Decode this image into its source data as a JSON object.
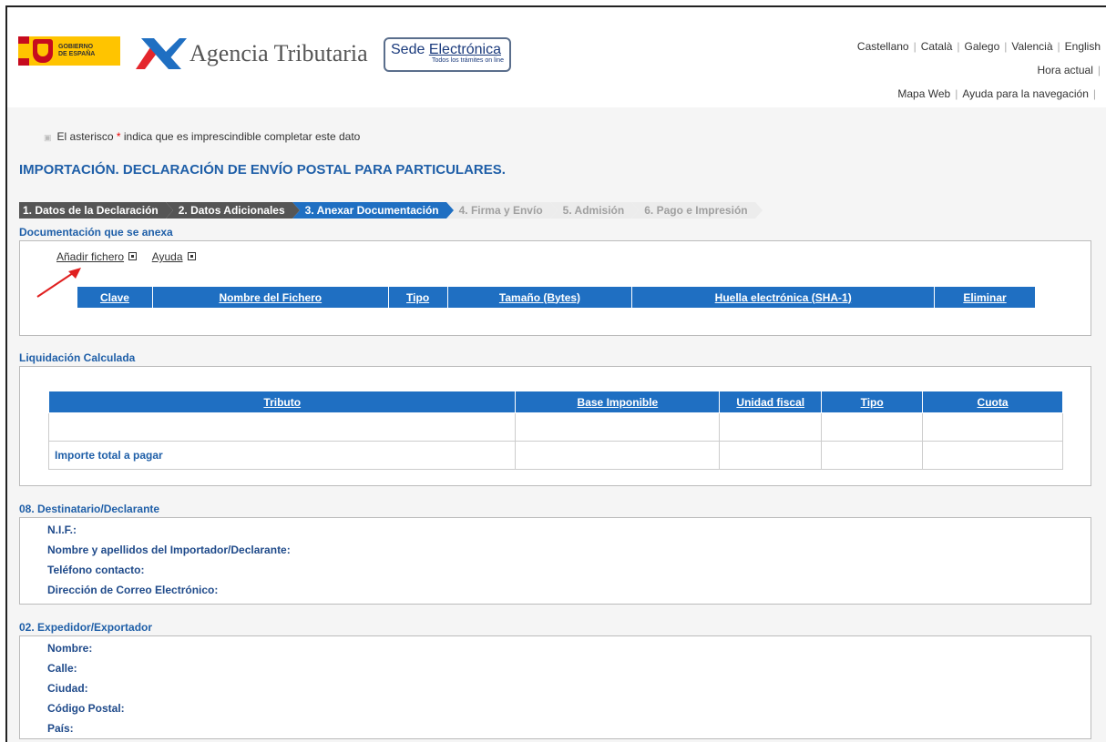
{
  "header": {
    "gob_text": [
      "GOBIERNO",
      "DE ESPAÑA"
    ],
    "agency_name": "Agencia Tributaria",
    "sede_title_prefix": "Sede ",
    "sede_title_link": "Electrónica",
    "sede_subtitle": "Todos los trámites on line",
    "languages": [
      "Castellano",
      "Català",
      "Galego",
      "Valencià",
      "English"
    ],
    "hora_actual": "Hora actual",
    "mapa_web": "Mapa Web",
    "ayuda_navegacion": "Ayuda para la navegación"
  },
  "note": {
    "prefix": "El asterisco ",
    "asterisk": "*",
    "suffix": " indica que es imprescindible completar este dato"
  },
  "page_title": "IMPORTACIÓN. DECLARACIÓN DE ENVÍO POSTAL PARA PARTICULARES.",
  "steps": [
    {
      "label": "1. Datos de la Declaración",
      "state": "done"
    },
    {
      "label": "2. Datos Adicionales",
      "state": "done"
    },
    {
      "label": "3. Anexar Documentación",
      "state": "active"
    },
    {
      "label": "4. Firma y Envío",
      "state": "todo"
    },
    {
      "label": "5. Admisión",
      "state": "todo"
    },
    {
      "label": "6. Pago e Impresión",
      "state": "todo"
    }
  ],
  "documentacion": {
    "title": "Documentación que se anexa",
    "add_file": "Añadir fichero",
    "help": "Ayuda",
    "columns": [
      "Clave",
      "Nombre del Fichero",
      "Tipo",
      "Tamaño (Bytes)",
      "Huella electrónica (SHA-1)",
      "Eliminar"
    ]
  },
  "liquidacion": {
    "title": "Liquidación Calculada",
    "columns": [
      "Tributo",
      "Base Imponible",
      "Unidad fiscal",
      "Tipo",
      "Cuota"
    ],
    "total_label": "Importe total a pagar"
  },
  "destinatario": {
    "title": "08. Destinatario/Declarante",
    "fields": [
      "N.I.F.:",
      "Nombre y apellidos del Importador/Declarante:",
      "Teléfono contacto:",
      "Dirección de Correo Electrónico:"
    ]
  },
  "expedidor": {
    "title": "02. Expedidor/Exportador",
    "fields": [
      "Nombre:",
      "Calle:",
      "Ciudad:",
      "Código Postal:",
      "País:"
    ]
  },
  "colors": {
    "accent_blue": "#1f6fc2",
    "title_blue": "#1f5fa8",
    "annotation_arrow": "#e02020"
  }
}
